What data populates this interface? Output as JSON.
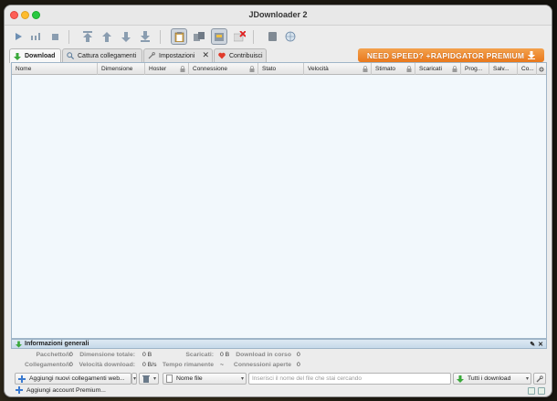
{
  "window": {
    "title": "JDownloader 2"
  },
  "tabs": [
    {
      "label": "Download",
      "icon": "download-arrow-icon"
    },
    {
      "label": "Cattura collegamenti",
      "icon": "magnifier-icon"
    },
    {
      "label": "Impostazioni",
      "icon": "settings-icon"
    },
    {
      "label": "Contribuisci",
      "icon": "heart-icon"
    }
  ],
  "banner": {
    "text": "NEED SPEED? +RAPIDGATOR PREMIUM"
  },
  "columns": [
    "Nome",
    "Dimensione",
    "Hoster",
    "Connessione",
    "Stato",
    "Velocità",
    "Stimato",
    "Scaricati",
    "Prog...",
    "Salv...",
    "Co..."
  ],
  "panel": {
    "title": "Informazioni generali",
    "stats": {
      "pacchetti_label": "Pacchetto/i:",
      "pacchetti_value": "0",
      "dimensione_label": "Dimensione totale:",
      "dimensione_value": "0 B",
      "scaricati_label": "Scaricati:",
      "scaricati_value": "0 B",
      "incorso_label": "Download in corso",
      "incorso_value": "0",
      "collegamenti_label": "Collegamento/i:",
      "collegamenti_value": "0",
      "velocita_label": "Velocità download:",
      "velocita_value": "0 B/s",
      "tempo_label": "Tempo rimanente",
      "tempo_value": "~",
      "connessioni_label": "Connessioni aperte",
      "connessioni_value": "0"
    }
  },
  "bottom": {
    "add_links": "Aggiungi nuovi collegamenti web...",
    "sort_field": "Nome file",
    "search_placeholder": "Inserisci il nome del file che stai cercando",
    "filter": "Tutti i download"
  },
  "status": {
    "premium": "Aggiungi account Premium..."
  },
  "colors": {
    "accent_green": "#3aa83a",
    "banner_orange": "#e9781c",
    "list_bg": "#f2f8fc"
  }
}
